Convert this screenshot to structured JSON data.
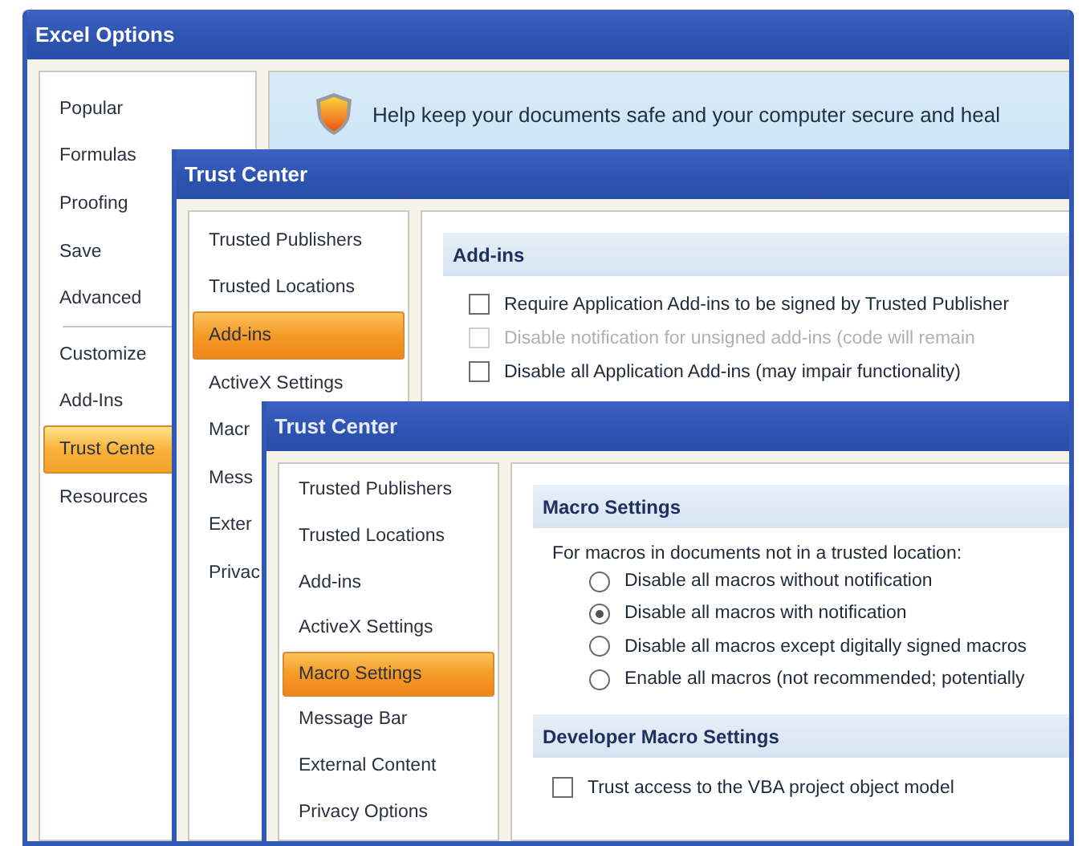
{
  "excel_options": {
    "title": "Excel Options",
    "nav_groups": [
      [
        {
          "label": "Popular",
          "selected": false
        },
        {
          "label": "Formulas",
          "selected": false
        },
        {
          "label": "Proofing",
          "selected": false
        },
        {
          "label": "Save",
          "selected": false
        },
        {
          "label": "Advanced",
          "selected": false
        }
      ],
      [
        {
          "label": "Customize",
          "selected": false
        },
        {
          "label": "Add-Ins",
          "selected": false
        },
        {
          "label": "Trust Cente",
          "selected": true
        },
        {
          "label": "Resources",
          "selected": false
        }
      ]
    ],
    "banner": "Help keep your documents safe and your computer secure and heal"
  },
  "trust_center_addins": {
    "title": "Trust Center",
    "nav": [
      {
        "label": "Trusted Publishers",
        "selected": false
      },
      {
        "label": "Trusted Locations",
        "selected": false
      },
      {
        "label": "Add-ins",
        "selected": true
      },
      {
        "label": "ActiveX Settings",
        "selected": false
      },
      {
        "label": "Macr",
        "selected": false
      },
      {
        "label": "Mess",
        "selected": false
      },
      {
        "label": "Exter",
        "selected": false
      },
      {
        "label": "Privac",
        "selected": false
      }
    ],
    "section": "Add-ins",
    "options": [
      {
        "label": "Require Application Add-ins to be signed by Trusted Publisher",
        "checked": false,
        "disabled": false
      },
      {
        "label": "Disable notification for unsigned add-ins (code will remain",
        "checked": false,
        "disabled": true
      },
      {
        "label": "Disable all Application Add-ins (may impair functionality)",
        "checked": false,
        "disabled": false
      }
    ]
  },
  "trust_center_macros": {
    "title": "Trust Center",
    "nav": [
      {
        "label": "Trusted Publishers",
        "selected": false
      },
      {
        "label": "Trusted Locations",
        "selected": false
      },
      {
        "label": "Add-ins",
        "selected": false
      },
      {
        "label": "ActiveX Settings",
        "selected": false
      },
      {
        "label": "Macro Settings",
        "selected": true
      },
      {
        "label": "Message Bar",
        "selected": false
      },
      {
        "label": "External Content",
        "selected": false
      },
      {
        "label": "Privacy Options",
        "selected": false
      }
    ],
    "section": "Macro Settings",
    "intro": "For macros in documents not in a trusted location:",
    "radios": [
      {
        "label": "Disable all macros without notification",
        "selected": false
      },
      {
        "label": "Disable all macros with notification",
        "selected": true
      },
      {
        "label": "Disable all macros except digitally signed macros",
        "selected": false
      },
      {
        "label": "Enable all macros (not recommended; potentially",
        "selected": false
      }
    ],
    "developer_section": "Developer Macro Settings",
    "developer_options": [
      {
        "label": "Trust access to the VBA project object model",
        "checked": false,
        "disabled": false
      }
    ]
  }
}
